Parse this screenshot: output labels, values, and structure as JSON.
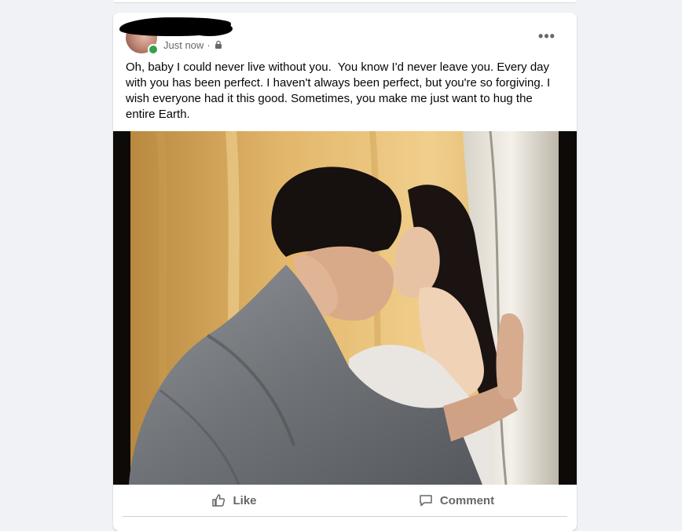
{
  "post": {
    "timestamp": "Just now",
    "separator": "·",
    "privacy_icon": "lock-icon",
    "more_icon": "more-options-icon",
    "more_label": "•••",
    "text": "Oh, baby I could never live without you.  You know I'd never leave you. Every day with you has been perfect. I haven't always been perfect, but you're so forgiving. I wish everyone had it this good. Sometimes, you make me just want to hug the entire Earth."
  },
  "actions": {
    "like_label": "Like",
    "like_icon": "thumbs-up-icon",
    "comment_label": "Comment",
    "comment_icon": "comment-bubble-icon"
  },
  "colors": {
    "online": "#31a24c",
    "meta_text": "#65676b",
    "background": "#f0f2f5"
  }
}
